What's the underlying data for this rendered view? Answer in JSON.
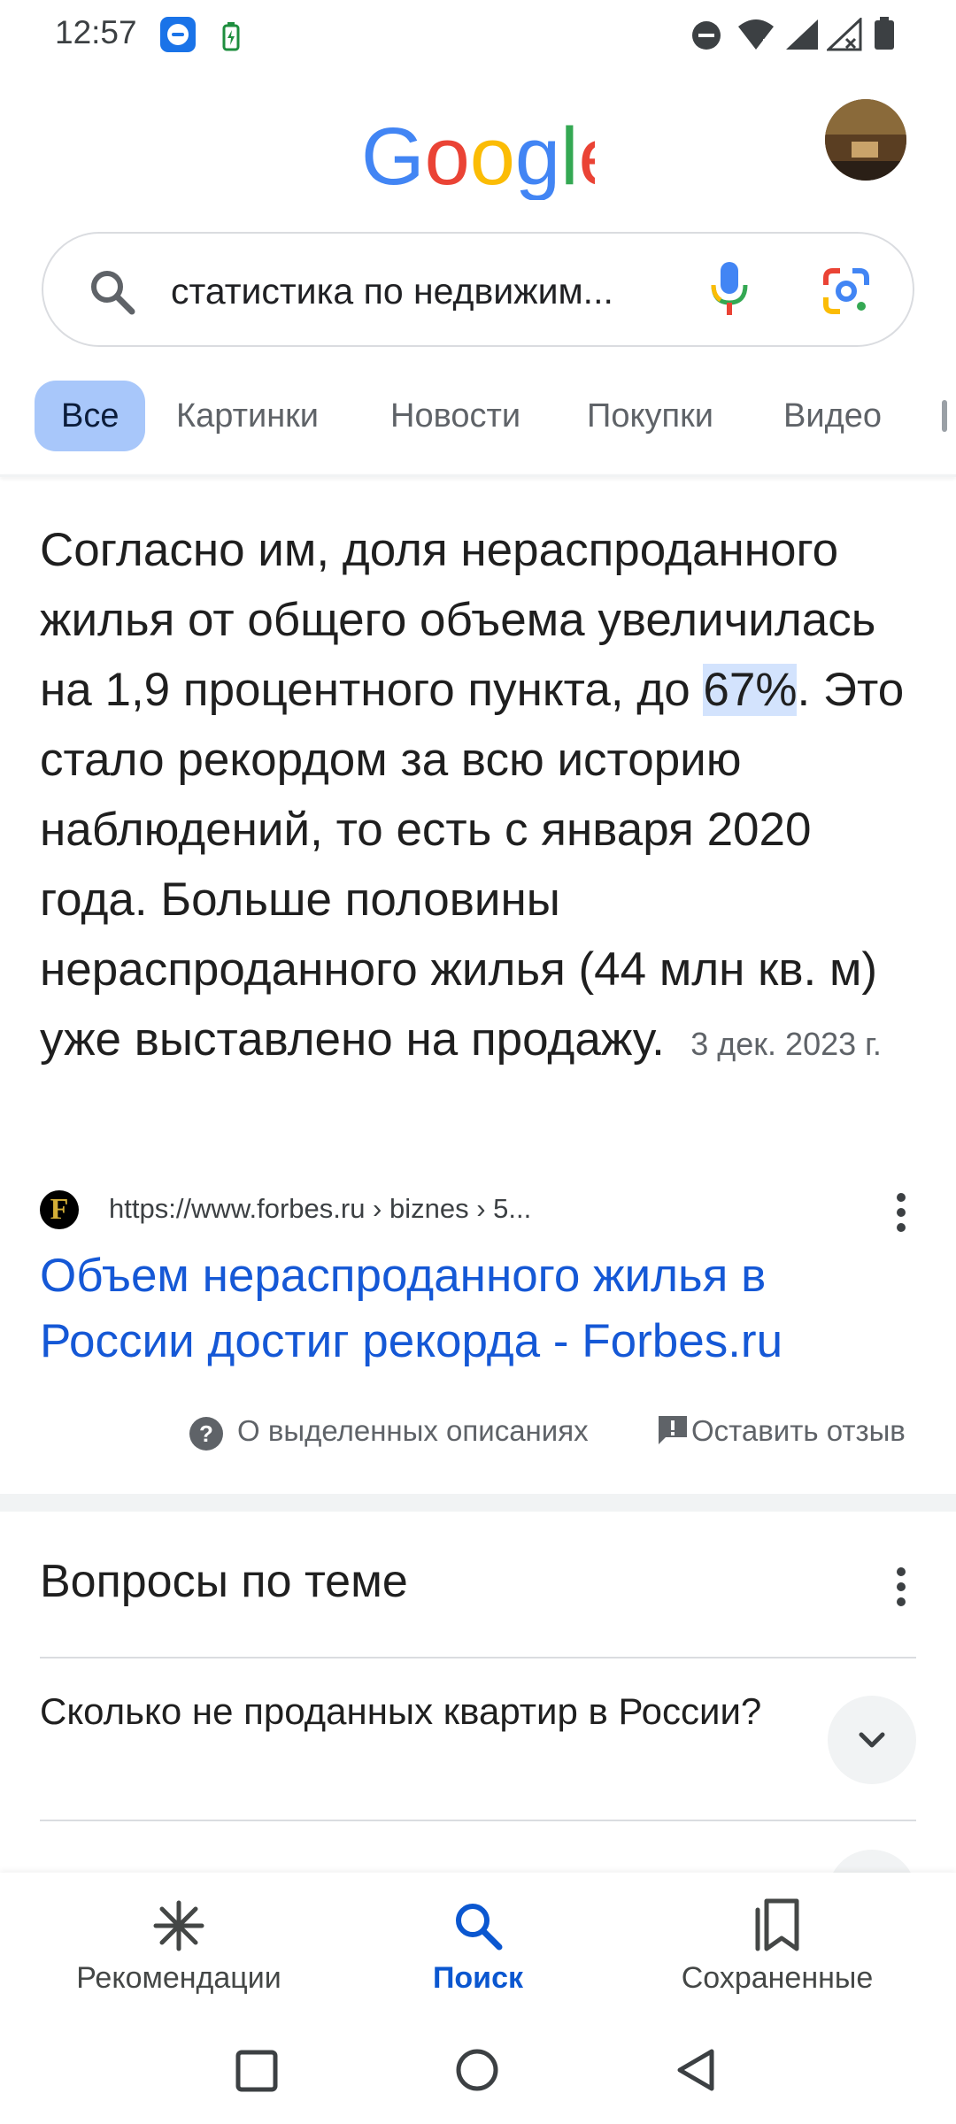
{
  "status_bar": {
    "time": "12:57"
  },
  "header": {
    "logo_text": "Google"
  },
  "search": {
    "query": "статистика по недвижим..."
  },
  "tabs": [
    {
      "label": "Все",
      "active": true
    },
    {
      "label": "Картинки",
      "active": false
    },
    {
      "label": "Новости",
      "active": false
    },
    {
      "label": "Покупки",
      "active": false
    },
    {
      "label": "Видео",
      "active": false
    }
  ],
  "snippet": {
    "text_before": "Согласно им, доля нераспроданного жилья от общего объема увеличилась на 1,9 процентного пункта, до ",
    "highlight": "67%",
    "text_after": ". Это стало рекордом за всю историю наблюдений, то есть с января 2020 года. Больше половины нераспроданного жилья (44 млн кв. м) уже выставлено на продажу.",
    "date": "3 дек. 2023 г."
  },
  "source": {
    "favicon_letter": "F",
    "url": "https://www.forbes.ru › biznes › 5...",
    "title": "Объем нераспроданного жилья в России достиг рекорда - Forbes.ru"
  },
  "snippet_footer": {
    "about": "О выделенных описаниях",
    "feedback": "Оставить отзыв"
  },
  "related_questions": {
    "title": "Вопросы по теме",
    "items": [
      {
        "question": "Сколько не проданных квартир в России?"
      }
    ]
  },
  "bottom_nav": [
    {
      "label": "Рекомендации",
      "icon": "asterisk-icon",
      "active": false
    },
    {
      "label": "Поиск",
      "icon": "search-icon",
      "active": true
    },
    {
      "label": "Сохраненные",
      "icon": "bookmarks-icon",
      "active": false
    }
  ],
  "colors": {
    "accent_blue": "#0b57d0",
    "link_blue": "#1558d6",
    "active_tab_bg": "#a8c7fa",
    "highlight_bg": "#d3e3fd"
  }
}
